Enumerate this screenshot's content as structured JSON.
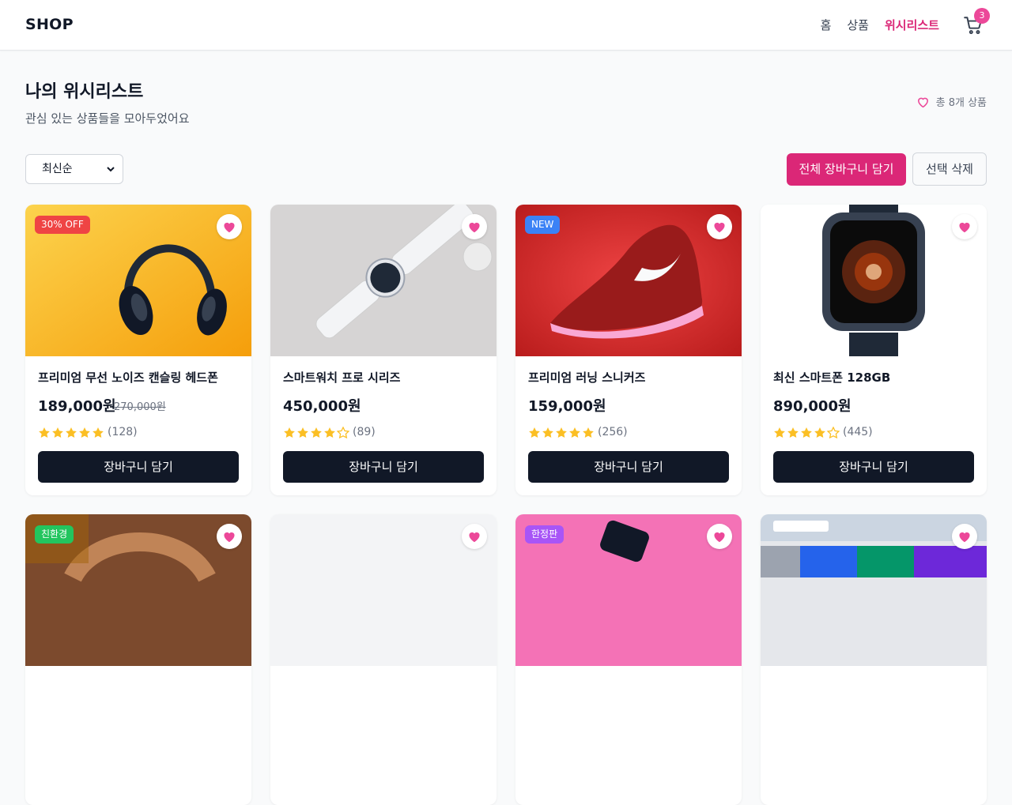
{
  "header": {
    "logo": "SHOP",
    "nav": [
      "홈",
      "상품",
      "위시리스트"
    ],
    "cart_count": "3"
  },
  "page": {
    "title": "나의 위시리스트",
    "subtitle": "관심 있는 상품들을 모아두었어요",
    "total": "총 8개 상품"
  },
  "toolbar": {
    "sort_selected": "최신순",
    "add_all_label": "전체 장바구니 담기",
    "delete_label": "선택 삭제"
  },
  "products": [
    {
      "name": "프리미엄 무선 노이즈 캔슬링 헤드폰",
      "price": "189,000원",
      "original_price": "270,000원",
      "tag": "30% OFF",
      "tag_color": "#ef4444",
      "rating": 5,
      "reviews": "(128)",
      "button": "장바구니 담기"
    },
    {
      "name": "스마트워치 프로 시리즈",
      "price": "450,000원",
      "original_price": "",
      "tag": "",
      "tag_color": "",
      "rating": 4,
      "reviews": "(89)",
      "button": "장바구니 담기"
    },
    {
      "name": "프리미엄 러닝 스니커즈",
      "price": "159,000원",
      "original_price": "",
      "tag": "NEW",
      "tag_color": "#3b82f6",
      "rating": 5,
      "reviews": "(256)",
      "button": "장바구니 담기"
    },
    {
      "name": "최신 스마트폰 128GB",
      "price": "890,000원",
      "original_price": "",
      "tag": "",
      "tag_color": "",
      "rating": 4,
      "reviews": "(445)",
      "button": "장바구니 담기"
    }
  ],
  "products_row2": [
    {
      "tag": "친환경",
      "tag_color": "#22c55e"
    },
    {
      "tag": "",
      "tag_color": ""
    },
    {
      "tag": "한정판",
      "tag_color": "#a855f7"
    },
    {
      "tag": "",
      "tag_color": ""
    }
  ],
  "colors": {
    "accent": "#db2777",
    "heart": "#ec4899",
    "star": "#fbbf24",
    "dark_button": "#111827"
  },
  "icons": {
    "cart": "cart-icon",
    "heart": "heart-icon",
    "star": "star-icon"
  }
}
